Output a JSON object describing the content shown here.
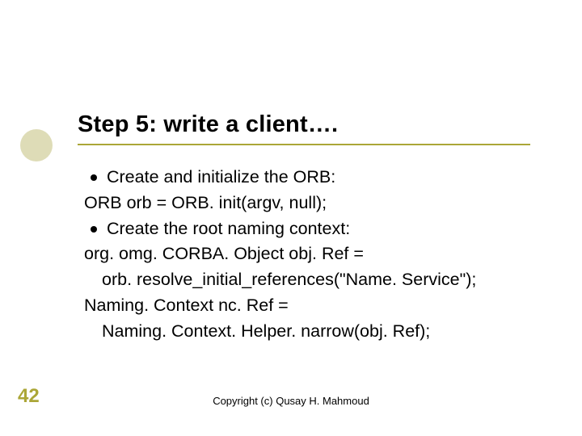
{
  "title": "Step 5: write a client….",
  "body": {
    "bullet1": "Create and initialize the ORB:",
    "line1": "ORB orb = ORB. init(argv, null);",
    "bullet2": "Create the root naming context:",
    "line2": "org. omg. CORBA. Object obj. Ref =",
    "line3": "orb. resolve_initial_references(\"Name. Service\");",
    "line4": "Naming. Context nc. Ref =",
    "line5": "Naming. Context. Helper. narrow(obj. Ref);"
  },
  "page_number": "42",
  "footer": "Copyright (c) Qusay H. Mahmoud"
}
